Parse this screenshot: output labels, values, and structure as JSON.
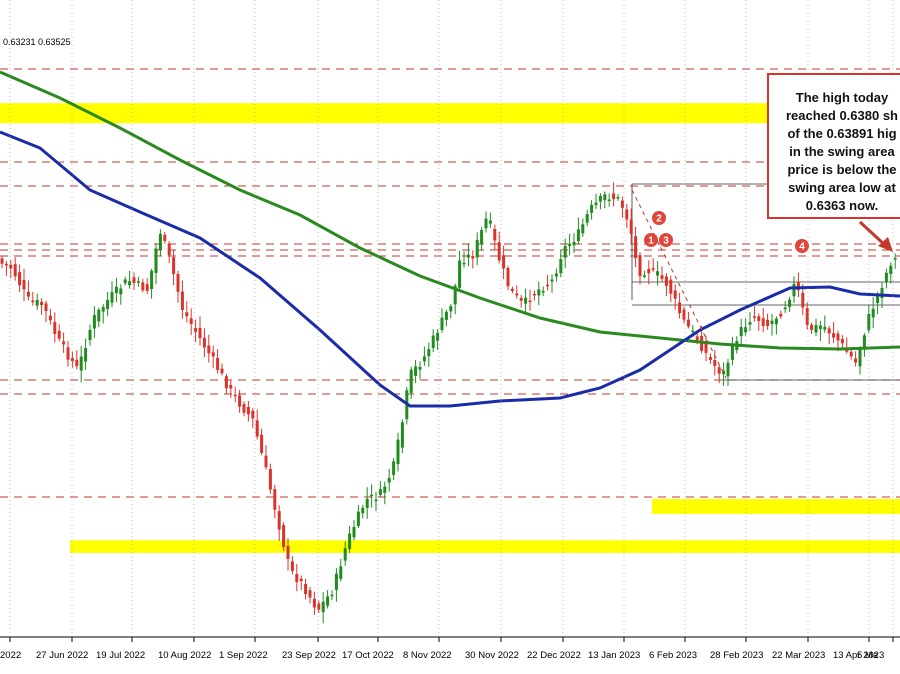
{
  "header": {
    "prices": "0.63231 0.63525"
  },
  "callout": {
    "lines": [
      "The high today",
      "reached 0.6380 sh",
      "of the 0.63891 hig",
      "in the swing area",
      "price is below the",
      "swing area low at",
      "0.6363 now."
    ]
  },
  "chart_data": {
    "type": "candlestick",
    "x_tick_labels": [
      "2022",
      "27 Jun 2022",
      "19 Jul 2022",
      "10 Aug 2022",
      "1 Sep 2022",
      "23 Sep 2022",
      "17 Oct 2022",
      "8 Nov 2022",
      "30 Nov 2022",
      "22 Dec 2022",
      "13 Jan 2023",
      "6 Feb 2023",
      "28 Feb 2023",
      "22 Mar 2023",
      "13 Apr 2023",
      "5 Ma"
    ],
    "ylim": [
      0.615,
      0.726
    ],
    "grid": false,
    "markers": [
      "1",
      "2",
      "3",
      "4"
    ],
    "zones": [
      {
        "name": "upper-zone",
        "y_low": 0.7045,
        "y_high": 0.708,
        "color": "#ffff00"
      },
      {
        "name": "swing-area",
        "y_low": 0.6363,
        "y_high": 0.63891,
        "color": "#ffff00"
      },
      {
        "name": "lower-zone",
        "y_low": 0.6295,
        "y_high": 0.6317,
        "color": "#ffff00"
      }
    ],
    "colors": {
      "up": "#1e8c1e",
      "down": "#d9342b",
      "ma_blue": "#1a2ca8",
      "ma_green": "#2b8a1f",
      "dashed": "#c0392b"
    }
  }
}
